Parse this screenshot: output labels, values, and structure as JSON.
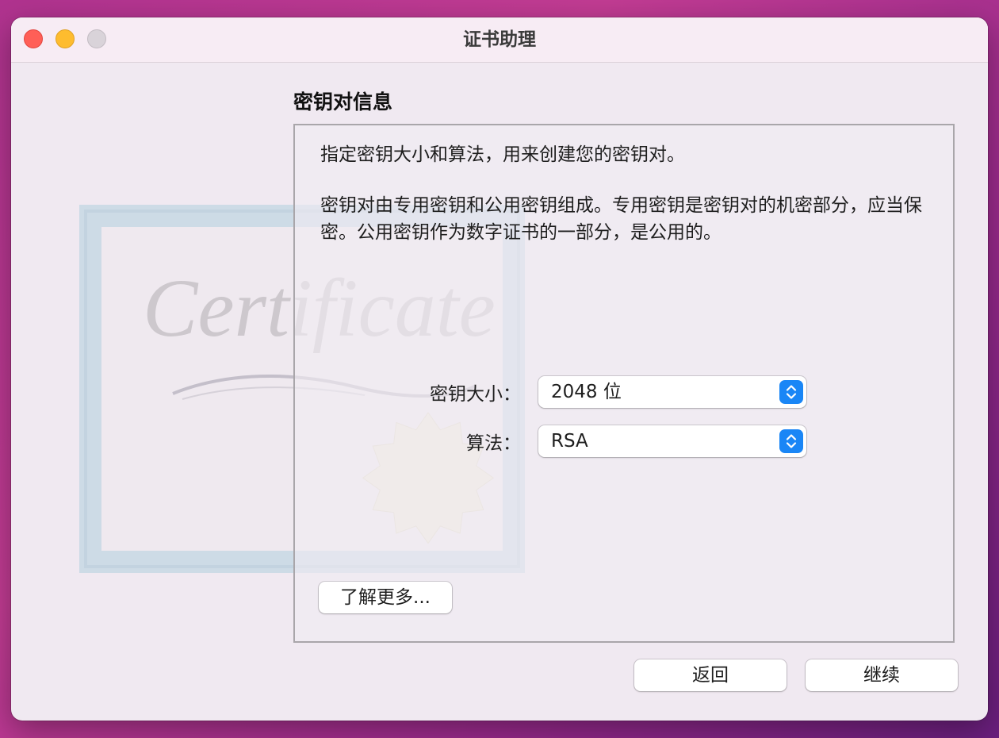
{
  "window": {
    "title": "证书助理"
  },
  "artwork": {
    "title": "Certificate"
  },
  "section": {
    "title": "密钥对信息"
  },
  "panel": {
    "intro": "指定密钥大小和算法，用来创建您的密钥对。",
    "description": "密钥对由专用密钥和公用密钥组成。专用密钥是密钥对的机密部分，应当保密。公用密钥作为数字证书的一部分，是公用的。",
    "key_size": {
      "label": "密钥大小：",
      "value": "2048 位"
    },
    "algorithm": {
      "label": "算法：",
      "value": "RSA"
    },
    "learn_more": "了解更多..."
  },
  "footer": {
    "back": "返回",
    "continue": "继续"
  },
  "colors": {
    "accent": "#1a86f6",
    "close": "#ff5f57",
    "minimize": "#febc2e"
  },
  "icons": [
    "close-icon",
    "minimize-icon",
    "zoom-icon",
    "up-down-chevron-icon",
    "certificate-seal-icon"
  ]
}
